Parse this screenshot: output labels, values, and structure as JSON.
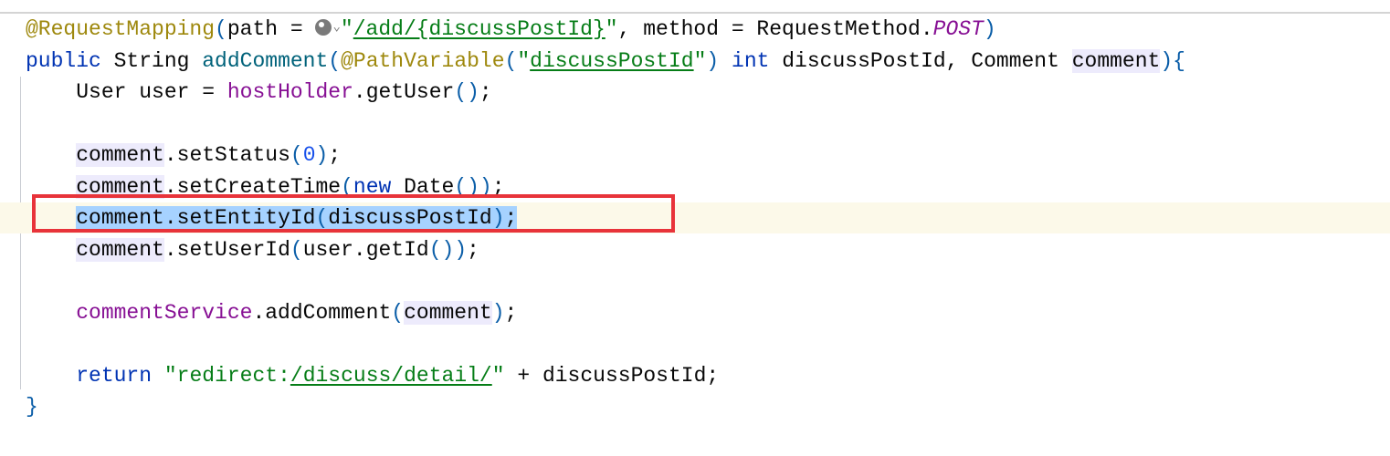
{
  "code": {
    "l1": {
      "annotation": "@RequestMapping",
      "open": "(",
      "param": "path = ",
      "quote_open": "\"",
      "path_value": "/add/{discussPostId}",
      "quote_close": "\"",
      "mid": ", method = RequestMethod.",
      "const": "POST",
      "close": ")"
    },
    "l2": {
      "kw_public": "public",
      "type": " String ",
      "method": "addComment",
      "open": "(",
      "annotation": "@PathVariable",
      "aopen": "(",
      "quote_open": "\"",
      "var_name": "discussPostId",
      "quote_close": "\"",
      "aclose": ")",
      "space": " ",
      "kw_int": "int",
      "params": " discussPostId, Comment ",
      "param_comment": "comment",
      "close": "){"
    },
    "l3": {
      "indent": "    ",
      "decl": "User user = ",
      "field": "hostHolder",
      "call": ".getUser",
      "parens": "()",
      "end": ";"
    },
    "l5": {
      "indent": "    ",
      "var": "comment",
      "call": ".setStatus",
      "open": "(",
      "num": "0",
      "close": ")",
      "end": ";"
    },
    "l6": {
      "indent": "    ",
      "var": "comment",
      "call": ".setCreateTime",
      "open": "(",
      "kw_new": "new",
      "rest": " Date",
      "parens": "())",
      "end": ";"
    },
    "l7": {
      "indent": "    ",
      "var": "comment",
      "call": ".setEntityId",
      "open": "(",
      "arg": "discussPostId",
      "close": ")",
      "end": ";"
    },
    "l8": {
      "indent": "    ",
      "var": "comment",
      "call": ".setUserId",
      "open": "(",
      "arg": "user.getId",
      "close": "())",
      "end": ";"
    },
    "l10": {
      "indent": "    ",
      "field": "commentService",
      "call": ".addComment",
      "open": "(",
      "arg": "comment",
      "close": ")",
      "end": ";"
    },
    "l12": {
      "indent": "    ",
      "kw_return": "return",
      "space": " ",
      "q1": "\"redirect:",
      "path": "/discuss/detail/",
      "q2": "\"",
      "rest": " + discussPostId;"
    },
    "l13": {
      "brace": "}"
    }
  },
  "colors": {
    "annotation": "#9e880d",
    "keyword": "#0033b3",
    "string": "#067d17",
    "field": "#871094",
    "selection": "#a6d2ff",
    "highlight_box": "#e8333a",
    "caret_row": "#fcf9e9"
  },
  "icons": {
    "inlay_hint": "globe-icon",
    "inlay_chevron": "chevron-down-icon"
  }
}
